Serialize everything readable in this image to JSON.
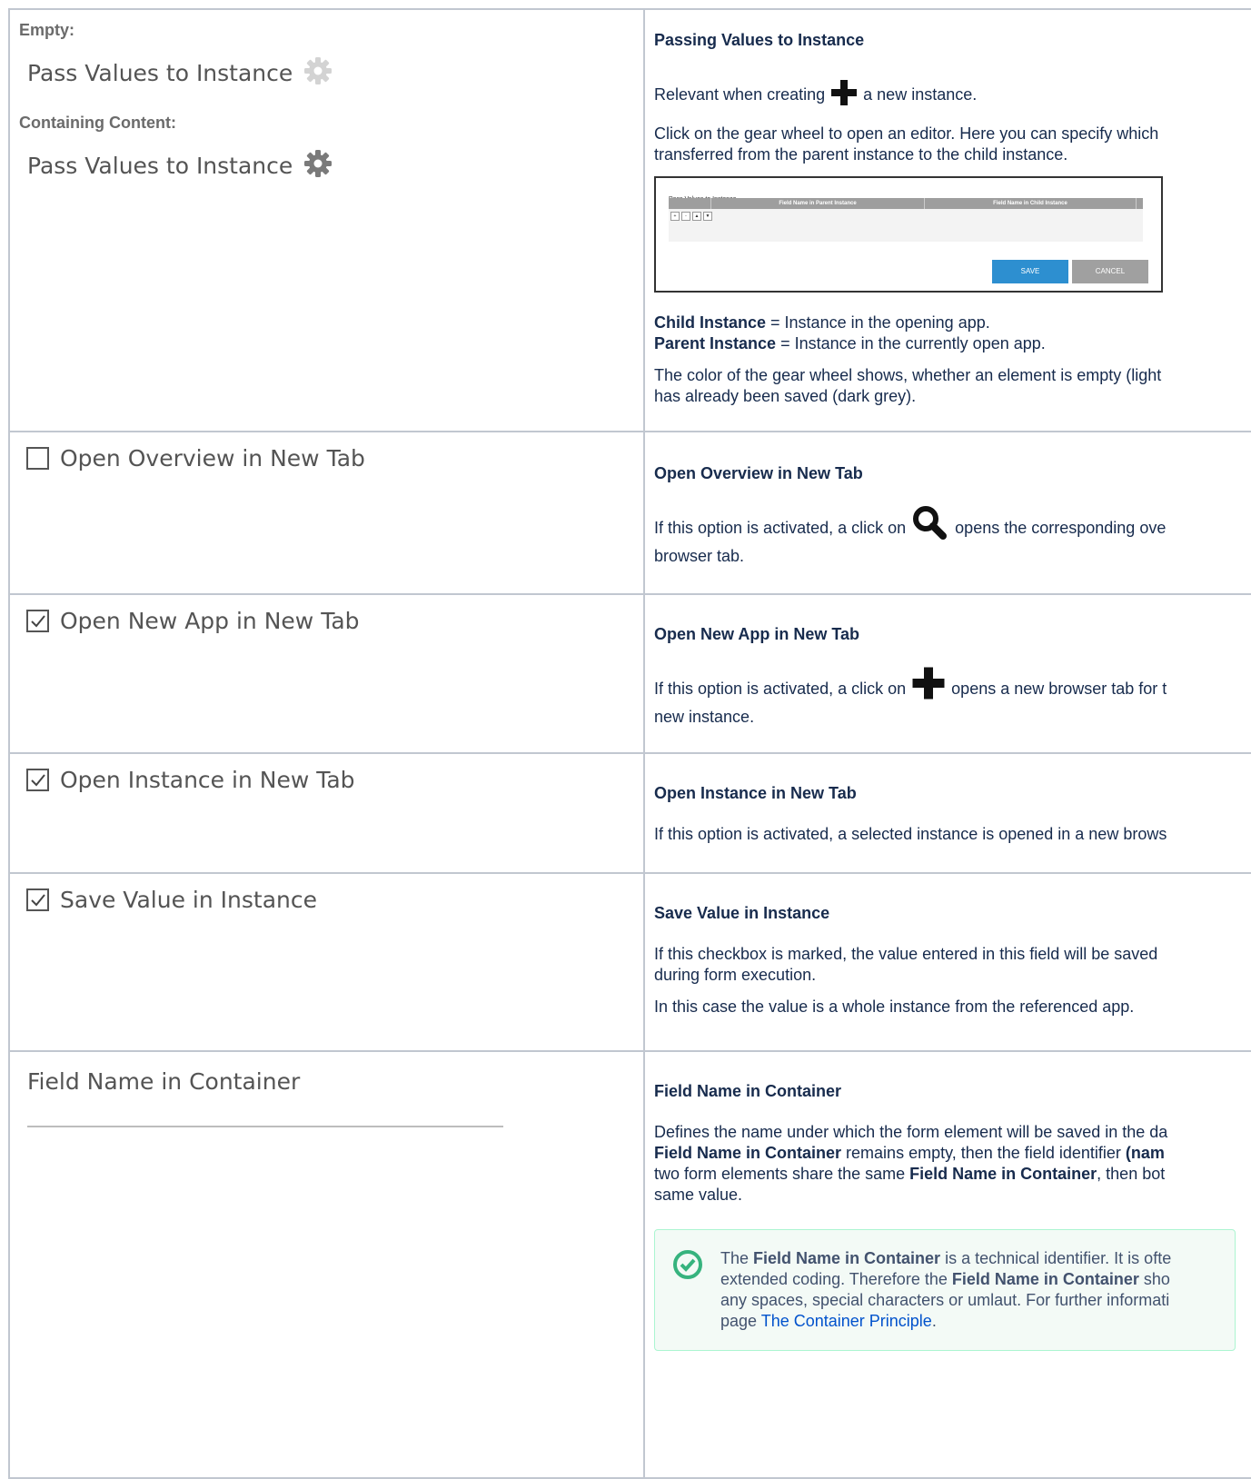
{
  "rows": [
    {
      "left": {
        "empty_label": "Empty:",
        "pass_values_label_1": "Pass Values to Instance",
        "containing_label": "Containing Content:",
        "pass_values_label_2": "Pass Values to Instance"
      },
      "right": {
        "heading": "Passing Values to Instance",
        "p1_before": "Relevant when creating",
        "p1_after": "a new instance.",
        "p2_line1": "Click on the gear wheel to open an editor. Here you can specify which",
        "p2_line2": "transferred from the parent instance to the child instance.",
        "dialog": {
          "title": "Pass Values to Instance",
          "col_parent": "Field Name in Parent Instance",
          "col_child": "Field Name in Child Instance",
          "save": "SAVE",
          "cancel": "CANCEL"
        },
        "child_term": "Child Instance",
        "child_def": " = Instance in the opening app.",
        "parent_term": "Parent Instance",
        "parent_def": " = Instance in the currently open app.",
        "p4_line1": "The color of the gear wheel shows, whether an element is empty (light",
        "p4_line2": "has already been saved (dark grey)."
      }
    },
    {
      "left": {
        "label": "Open Overview in New Tab",
        "checked": false
      },
      "right": {
        "heading": "Open Overview in New Tab",
        "p_before": "If this option is activated, a click on",
        "p_after": "opens the corresponding ove",
        "p_line2": "browser tab."
      }
    },
    {
      "left": {
        "label": "Open New App in New Tab",
        "checked": true
      },
      "right": {
        "heading": "Open New App in New Tab",
        "p_before": "If this option is activated, a click on",
        "p_after": "opens a new browser tab for t",
        "p_line2": "new instance."
      }
    },
    {
      "left": {
        "label": "Open Instance in New Tab",
        "checked": true
      },
      "right": {
        "heading": "Open Instance in New Tab",
        "p1": "If this option is activated, a selected instance is opened in a new brows"
      }
    },
    {
      "left": {
        "label": "Save Value in Instance",
        "checked": true
      },
      "right": {
        "heading": "Save Value in Instance",
        "p1_line1": "If this checkbox is marked, the value entered in this field will be saved",
        "p1_line2": "during form execution.",
        "p2": "In this case the value is a whole instance from the referenced app."
      }
    },
    {
      "left": {
        "label": "Field Name in Container",
        "input_value": ""
      },
      "right": {
        "heading": "Field Name in Container",
        "l1": "Defines the name under which the form element will be saved in the da",
        "l2_b1": "Field Name in Container",
        "l2_t1": " remains empty, then the field identifier ",
        "l2_b2": "(nam",
        "l3_t1": "two form elements share the same ",
        "l3_b1": "Field Name in Container",
        "l3_t2": ", then bot",
        "l4": "same value.",
        "note": {
          "n1_t1": "The ",
          "n1_b1": "Field Name in Container",
          "n1_t2": " is a technical identifier. It is ofte",
          "n2_t1": "extended coding. Therefore the ",
          "n2_b1": "Field Name in Container",
          "n2_t2": " sho",
          "n3": "any spaces, special characters or umlaut. For further informati",
          "n4_t1": "page ",
          "n4_link": "The Container Principle",
          "n4_t2": "."
        }
      }
    }
  ],
  "colors": {
    "gear_light": "#d3d3d3",
    "gear_dark": "#7a7a7a",
    "border": "#c1c7d0",
    "note_icon": "#36b37e"
  }
}
